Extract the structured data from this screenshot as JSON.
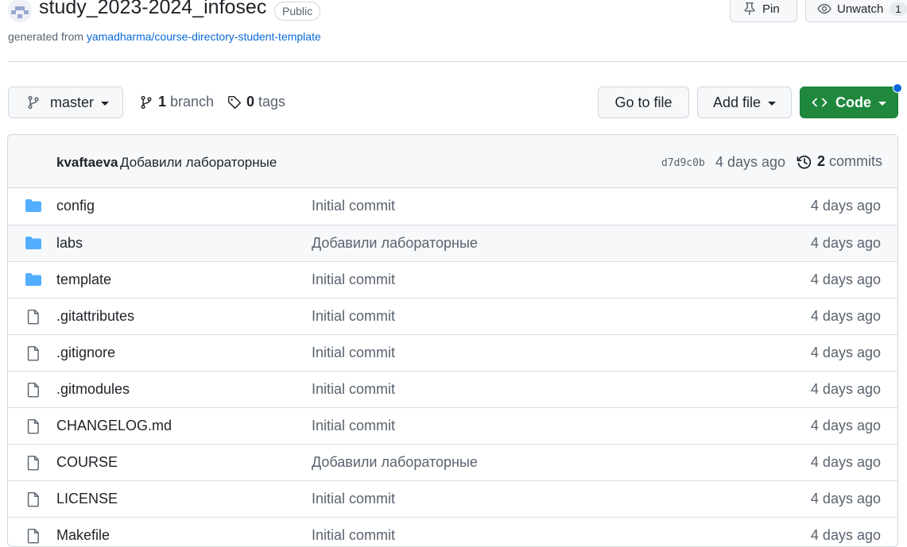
{
  "repo": {
    "name": "study_2023-2024_infosec",
    "visibility": "Public",
    "generated_prefix": "generated from ",
    "template_link": "yamadharma/course-directory-student-template"
  },
  "header_actions": {
    "pin_label": "Pin",
    "unwatch_label": "Unwatch",
    "watch_count": "1"
  },
  "toolbar": {
    "branch": "master",
    "branch_count": "1",
    "branch_word": "branch",
    "tag_count": "0",
    "tag_word": "tags",
    "go_to_file": "Go to file",
    "add_file": "Add file",
    "code": "Code"
  },
  "latest_commit": {
    "author": "kvaftaeva",
    "message": "Добавили лабораторные",
    "sha": "d7d9c0b",
    "time": "4 days ago",
    "commit_count": "2",
    "commit_word": "commits"
  },
  "files": [
    {
      "type": "folder",
      "name": "config",
      "message": "Initial commit",
      "age": "4 days ago"
    },
    {
      "type": "folder",
      "name": "labs",
      "message": "Добавили лабораторные",
      "age": "4 days ago"
    },
    {
      "type": "folder",
      "name": "template",
      "message": "Initial commit",
      "age": "4 days ago"
    },
    {
      "type": "file",
      "name": ".gitattributes",
      "message": "Initial commit",
      "age": "4 days ago"
    },
    {
      "type": "file",
      "name": ".gitignore",
      "message": "Initial commit",
      "age": "4 days ago"
    },
    {
      "type": "file",
      "name": ".gitmodules",
      "message": "Initial commit",
      "age": "4 days ago"
    },
    {
      "type": "file",
      "name": "CHANGELOG.md",
      "message": "Initial commit",
      "age": "4 days ago"
    },
    {
      "type": "file",
      "name": "COURSE",
      "message": "Добавили лабораторные",
      "age": "4 days ago"
    },
    {
      "type": "file",
      "name": "LICENSE",
      "message": "Initial commit",
      "age": "4 days ago"
    },
    {
      "type": "file",
      "name": "Makefile",
      "message": "Initial commit",
      "age": "4 days ago"
    }
  ],
  "colors": {
    "accent": "#0969da",
    "code_button": "#1f883d",
    "folder_icon": "#54aeff"
  }
}
